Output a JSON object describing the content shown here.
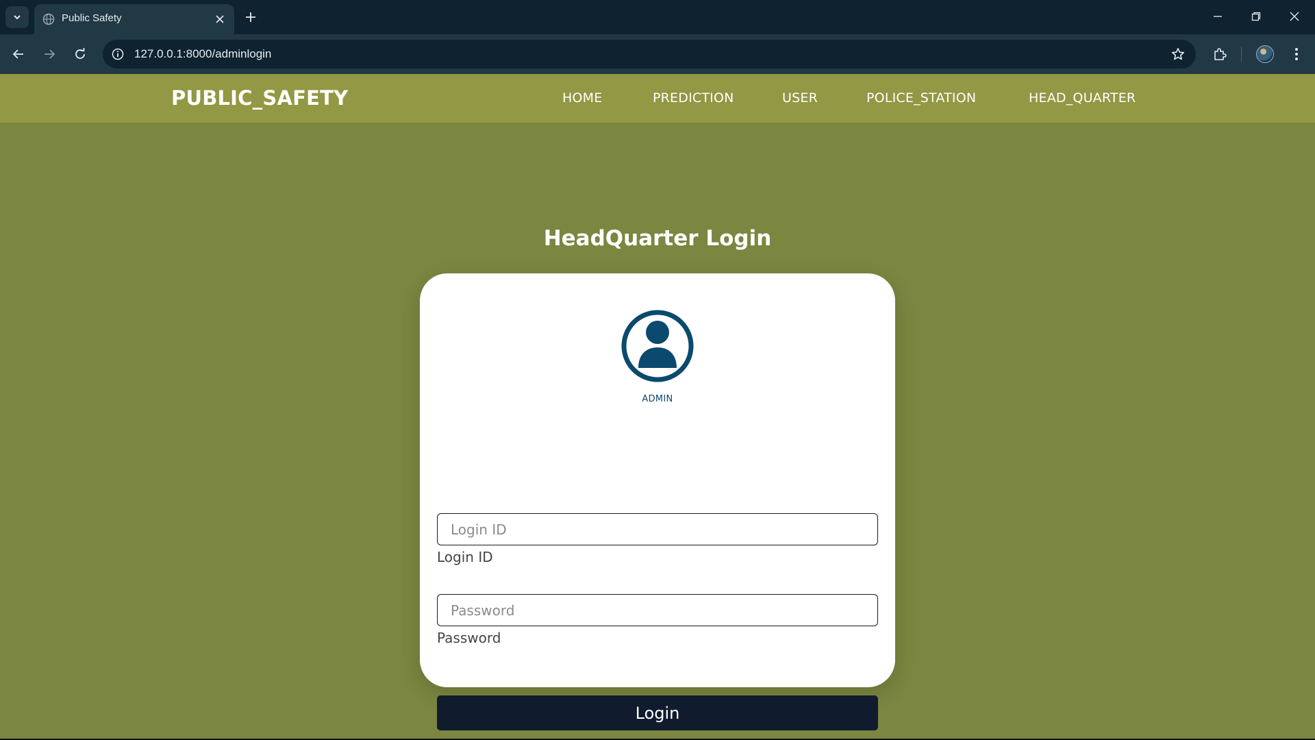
{
  "browser": {
    "tab_title": "Public Safety",
    "url": "127.0.0.1:8000/adminlogin"
  },
  "site": {
    "brand": "PUBLIC_SAFETY",
    "nav": {
      "home": "HOME",
      "prediction": "PREDICTION",
      "user": "USER",
      "police_station": "POLICE_STATION",
      "head_quarter": "HEAD_QUARTER"
    }
  },
  "login": {
    "heading": "HeadQuarter Login",
    "role_label": "ADMIN",
    "login_id": {
      "placeholder": "Login ID",
      "label": "Login ID",
      "value": ""
    },
    "password": {
      "placeholder": "Password",
      "label": "Password",
      "value": ""
    },
    "submit_label": "Login"
  },
  "colors": {
    "nav_bar": "#929843",
    "page_bg": "#7b8640",
    "icon_blue": "#0b4a6e",
    "button_bg": "#101c2e"
  },
  "icons": [
    "tab-list-icon",
    "globe-icon",
    "close-icon",
    "plus-icon",
    "minimize-icon",
    "restore-icon",
    "back-icon",
    "forward-icon",
    "reload-icon",
    "info-icon",
    "star-icon",
    "extensions-icon",
    "menu-icon",
    "user-circle-icon"
  ]
}
